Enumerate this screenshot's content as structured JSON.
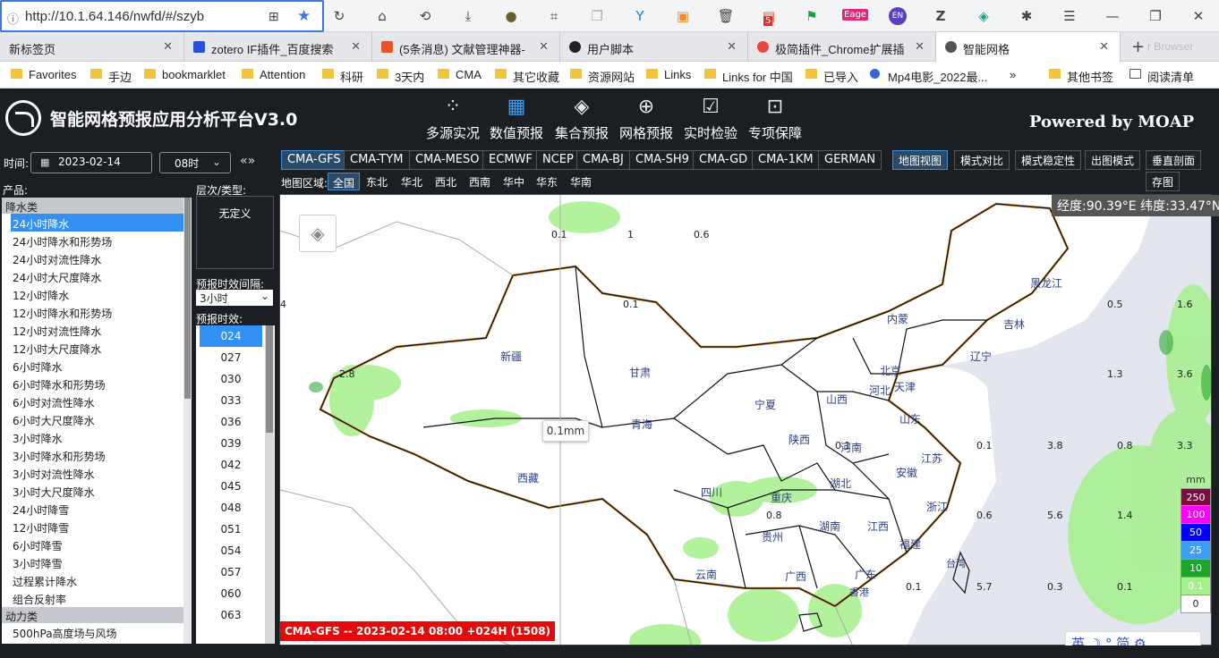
{
  "browser": {
    "url": "http://10.1.64.146/nwfd/#/szyb",
    "tabs": [
      {
        "label": "新标签页",
        "fav": "#ffffff"
      },
      {
        "label": "zotero IF插件_百度搜索",
        "fav": "#2b4fd8"
      },
      {
        "label": "(5条消息) 文献管理神器-",
        "fav": "#e5532d"
      },
      {
        "label": "用户脚本",
        "fav": "#222222"
      },
      {
        "label": "极简插件_Chrome扩展插",
        "fav": "#e24a3b"
      },
      {
        "label": "智能网格",
        "fav": "#555555"
      }
    ],
    "ghost_tab": "r Browser",
    "bookmarks": [
      "Favorites",
      "手边",
      "bookmarklet",
      "Attention",
      "科研",
      "3天内",
      "CMA",
      "其它收藏",
      "资源网站",
      "Links",
      "Links for 中国",
      "已导入",
      "Mp4电影_2022最...",
      "其他书签",
      "阅读清单"
    ],
    "more_bookmarks": "»",
    "ext_badge": "Eage",
    "ext_en": "EN",
    "ext_num": "5"
  },
  "app": {
    "title": "智能网格预报应用分析平台V3.0",
    "powered": "Powered by MOAP",
    "nav": [
      "多源实况",
      "数值预报",
      "集合预报",
      "网格预报",
      "实时检验",
      "专项保障"
    ],
    "time_label": "时间:",
    "date": "2023-02-14",
    "hour": "08时",
    "prevnext": "«»",
    "product_label": "产品:",
    "categories": [
      "降水类",
      "动力类"
    ],
    "products": [
      "24小时降水",
      "24小时降水和形势场",
      "24小时对流性降水",
      "24小时大尺度降水",
      "12小时降水",
      "12小时降水和形势场",
      "12小时对流性降水",
      "12小时大尺度降水",
      "6小时降水",
      "6小时降水和形势场",
      "6小时对流性降水",
      "6小时大尺度降水",
      "3小时降水",
      "3小时降水和形势场",
      "3小时对流性降水",
      "3小时大尺度降水",
      "24小时降雪",
      "12小时降雪",
      "6小时降雪",
      "3小时降雪",
      "过程累计降水",
      "组合反射率"
    ],
    "dyn_first": "500hPa高度场与风场",
    "layer_label": "层次/类型:",
    "layer_value": "无定义",
    "interval_label": "预报时效间隔:",
    "interval": "3小时",
    "timestep_label": "预报时效:",
    "timesteps": [
      "024",
      "027",
      "030",
      "033",
      "036",
      "039",
      "042",
      "045",
      "048",
      "051",
      "054",
      "057",
      "060",
      "063"
    ],
    "models": [
      "CMA-GFS",
      "CMA-TYM",
      "CMA-MESO",
      "ECMWF",
      "NCEP",
      "CMA-BJ",
      "CMA-SH9",
      "CMA-GD",
      "CMA-1KM",
      "GERMAN"
    ],
    "views": [
      "地图视图",
      "模式对比",
      "模式稳定性",
      "出图模式",
      "垂直剖面"
    ],
    "save": "存图",
    "region_label": "地图区域:",
    "regions": [
      "全国",
      "东北",
      "华北",
      "西北",
      "西南",
      "华中",
      "华东",
      "华南"
    ],
    "coord": "经度:90.39°E 纬度:33.47°N",
    "tooltip": "0.1mm",
    "footer": "CMA-GFS -- 2023-02-14 08:00 +024H (1508)",
    "legend_unit": "mm",
    "legend": [
      {
        "v": "250",
        "c": "#7d0c3f"
      },
      {
        "v": "100",
        "c": "#ff00ff"
      },
      {
        "v": "50",
        "c": "#0000ff"
      },
      {
        "v": "25",
        "c": "#3e9ef5"
      },
      {
        "v": "10",
        "c": "#1fa32b"
      },
      {
        "v": "0.1",
        "c": "#a5f08c"
      },
      {
        "v": "0",
        "c": "#ffffff"
      }
    ],
    "provinces": [
      "黑龙江",
      "吉林",
      "辽宁",
      "内蒙",
      "北京",
      "河北",
      "天津",
      "山西",
      "山东",
      "甘肃",
      "宁夏",
      "陕西",
      "河南",
      "江苏",
      "安徽",
      "湖北",
      "浙江",
      "新疆",
      "青海",
      "西藏",
      "四川",
      "重庆",
      "贵州",
      "湖南",
      "江西",
      "福建",
      "云南",
      "广西",
      "广东",
      "台湾",
      "香港"
    ],
    "numbers": [
      "0.1",
      "1",
      "0.6",
      "0.1",
      "4",
      "2.8",
      "0.5",
      "1.6",
      "1.3",
      "3.6",
      "0.1",
      "0.1",
      "3.8",
      "0.8",
      "3.3",
      "0.8",
      "0.6",
      "5.6",
      "1.4",
      "0.1",
      "5.7",
      "0.3",
      "0.1"
    ],
    "ime": "英 ☽ ° 简 ⚙"
  }
}
